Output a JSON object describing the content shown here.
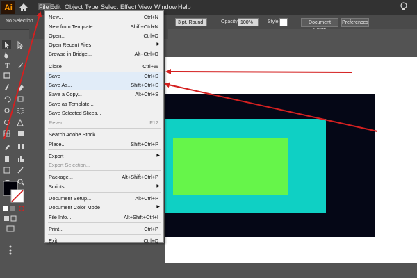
{
  "app": {
    "logo": "Ai"
  },
  "menubar": {
    "items": [
      "File",
      "Edit",
      "Object",
      "Type",
      "Select",
      "Effect",
      "View",
      "Window",
      "Help"
    ]
  },
  "controlbar": {
    "selection_label": "No Selection",
    "stroke_value": "3 pt. Round",
    "opacity_label": "Opacity:",
    "opacity_value": "100%",
    "style_label": "Style:",
    "document_setup": "Document Setup",
    "preferences": "Preferences"
  },
  "file_menu": {
    "items": [
      {
        "label": "New...",
        "shortcut": "Ctrl+N"
      },
      {
        "label": "New from Template...",
        "shortcut": "Shift+Ctrl+N"
      },
      {
        "label": "Open...",
        "shortcut": "Ctrl+O"
      },
      {
        "label": "Open Recent Files",
        "shortcut": ""
      },
      {
        "label": "Browse in Bridge...",
        "shortcut": "Alt+Ctrl+O"
      },
      {
        "label": "Close",
        "shortcut": "Ctrl+W"
      },
      {
        "label": "Save",
        "shortcut": "Ctrl+S"
      },
      {
        "label": "Save As...",
        "shortcut": "Shift+Ctrl+S"
      },
      {
        "label": "Save a Copy...",
        "shortcut": "Alt+Ctrl+S"
      },
      {
        "label": "Save as Template...",
        "shortcut": ""
      },
      {
        "label": "Save Selected Slices...",
        "shortcut": ""
      },
      {
        "label": "Revert",
        "shortcut": "F12"
      },
      {
        "label": "Search Adobe Stock...",
        "shortcut": ""
      },
      {
        "label": "Place...",
        "shortcut": "Shift+Ctrl+P"
      },
      {
        "label": "Export",
        "shortcut": ""
      },
      {
        "label": "Export Selection...",
        "shortcut": ""
      },
      {
        "label": "Package...",
        "shortcut": "Alt+Shift+Ctrl+P"
      },
      {
        "label": "Scripts",
        "shortcut": ""
      },
      {
        "label": "Document Setup...",
        "shortcut": "Alt+Ctrl+P"
      },
      {
        "label": "Document Color Mode",
        "shortcut": ""
      },
      {
        "label": "File Info...",
        "shortcut": "Alt+Shift+Ctrl+I"
      },
      {
        "label": "Print...",
        "shortcut": "Ctrl+P"
      },
      {
        "label": "Exit",
        "shortcut": "Ctrl+Q"
      }
    ]
  },
  "colors": {
    "accent_red": "#d42020",
    "dark_rect": "#050716",
    "cyan_rect": "#0fd0c4",
    "green_rect": "#66f54a"
  },
  "icons": [
    "home-icon",
    "lightbulb-icon",
    "selection-tool-icon",
    "direct-selection-tool-icon",
    "pen-tool-icon",
    "type-tool-icon",
    "line-tool-icon",
    "rectangle-tool-icon",
    "paintbrush-tool-icon",
    "eraser-tool-icon",
    "rotate-tool-icon",
    "scale-tool-icon",
    "warp-tool-icon",
    "free-transform-tool-icon",
    "shape-builder-tool-icon",
    "perspective-tool-icon",
    "mesh-tool-icon",
    "gradient-tool-icon",
    "eyedropper-tool-icon",
    "blend-tool-icon",
    "symbol-sprayer-tool-icon",
    "graph-tool-icon",
    "artboard-tool-icon",
    "slice-tool-icon",
    "hand-tool-icon",
    "zoom-tool-icon",
    "submenu-arrow-icon"
  ]
}
